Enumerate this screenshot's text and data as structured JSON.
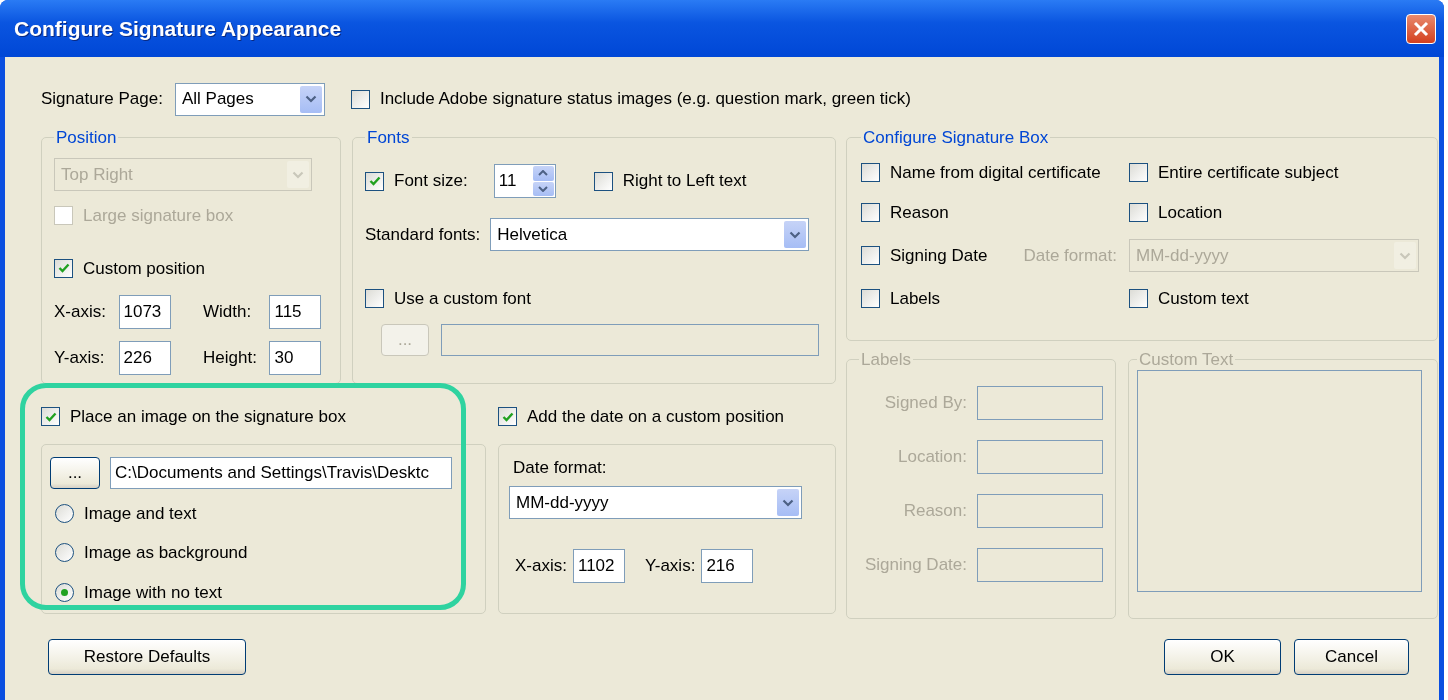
{
  "window": {
    "title": "Configure Signature Appearance"
  },
  "signature_page": {
    "label": "Signature Page:",
    "value": "All Pages"
  },
  "include_status_images": {
    "label": "Include Adobe signature status images (e.g. question mark, green tick)",
    "checked": false
  },
  "position": {
    "title": "Position",
    "dropdown": {
      "value": "Top Right",
      "disabled": true
    },
    "large_box": {
      "label": "Large signature box",
      "checked": false,
      "disabled": true
    },
    "custom_position": {
      "label": "Custom position",
      "checked": true
    },
    "fields": [
      {
        "label": "X-axis:",
        "value": "1073"
      },
      {
        "label": "Width:",
        "value": "115"
      },
      {
        "label": "Y-axis:",
        "value": "226"
      },
      {
        "label": "Height:",
        "value": "30"
      }
    ]
  },
  "fonts": {
    "title": "Fonts",
    "font_size": {
      "label": "Font size:",
      "checked": true,
      "value": "11"
    },
    "right_to_left": {
      "label": "Right to Left text",
      "checked": false
    },
    "standard_fonts": {
      "label": "Standard fonts:",
      "value": "Helvetica"
    },
    "custom_font": {
      "label": "Use a custom font",
      "checked": false
    },
    "browse_button": {
      "label": "...",
      "disabled": true
    }
  },
  "signature_box": {
    "title": "Configure Signature Box",
    "options": [
      {
        "label": "Name from digital certificate",
        "checked": false
      },
      {
        "label": "Entire certificate subject",
        "checked": false
      },
      {
        "label": "Reason",
        "checked": false
      },
      {
        "label": "Location",
        "checked": false
      },
      {
        "label": "Signing Date",
        "checked": false
      },
      {
        "label": "Labels",
        "checked": false
      },
      {
        "label": "Custom text",
        "checked": false
      }
    ],
    "date_format": {
      "label": "Date format:",
      "value": "MM-dd-yyyy",
      "disabled": true
    }
  },
  "labels": {
    "title": "Labels",
    "disabled": true,
    "fields": [
      {
        "label": "Signed By:"
      },
      {
        "label": "Location:"
      },
      {
        "label": "Reason:"
      },
      {
        "label": "Signing Date:"
      }
    ]
  },
  "custom_text": {
    "title": "Custom Text",
    "disabled": true
  },
  "image": {
    "label": "Place an image on the signature box",
    "checked": true,
    "browse_button": "...",
    "path": "C:\\Documents and Settings\\Travis\\Desktc",
    "options": [
      {
        "label": "Image and text",
        "selected": false
      },
      {
        "label": "Image as background",
        "selected": false
      },
      {
        "label": "Image with no text",
        "selected": true
      }
    ]
  },
  "custom_date": {
    "label": "Add the date on a custom position",
    "checked": true,
    "format_label": "Date format:",
    "format": "MM-dd-yyyy",
    "fields": [
      {
        "label": "X-axis:",
        "value": "1102"
      },
      {
        "label": "Y-axis:",
        "value": "216"
      }
    ]
  },
  "buttons": {
    "restore": "Restore Defaults",
    "ok": "OK",
    "cancel": "Cancel"
  }
}
